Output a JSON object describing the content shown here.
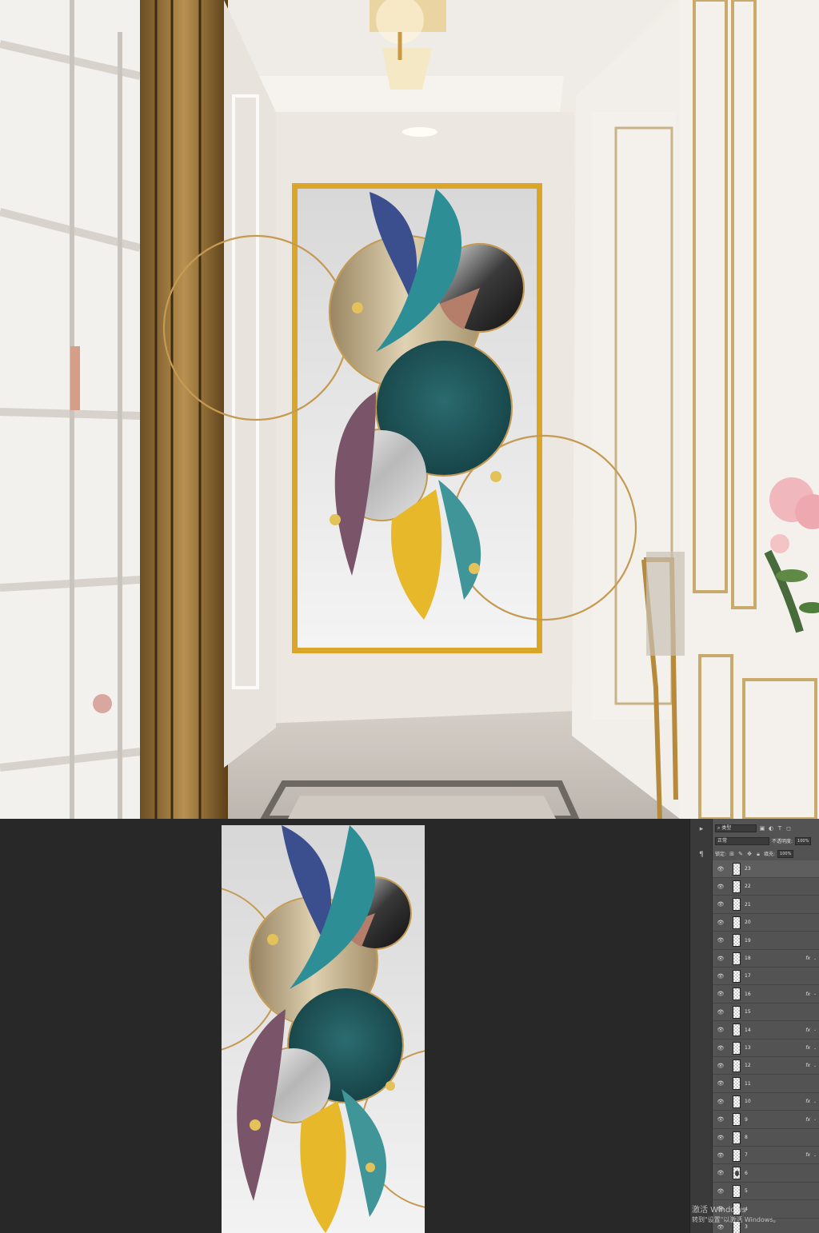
{
  "layers_panel": {
    "filter_kind": "类型",
    "blend_mode": "正常",
    "opacity_label": "不透明度:",
    "opacity_value": "100%",
    "lock_label": "锁定:",
    "fill_label": "填充:",
    "fill_value": "100%",
    "layers": [
      {
        "name": "23",
        "fx": false,
        "selected": true,
        "mark": false
      },
      {
        "name": "22",
        "fx": false,
        "selected": false,
        "mark": false
      },
      {
        "name": "21",
        "fx": false,
        "selected": false,
        "mark": false
      },
      {
        "name": "20",
        "fx": false,
        "selected": false,
        "mark": false
      },
      {
        "name": "19",
        "fx": false,
        "selected": false,
        "mark": false
      },
      {
        "name": "18",
        "fx": true,
        "selected": false,
        "mark": false
      },
      {
        "name": "17",
        "fx": false,
        "selected": false,
        "mark": false
      },
      {
        "name": "16",
        "fx": true,
        "selected": false,
        "mark": false
      },
      {
        "name": "15",
        "fx": false,
        "selected": false,
        "mark": false
      },
      {
        "name": "14",
        "fx": true,
        "selected": false,
        "mark": false
      },
      {
        "name": "13",
        "fx": true,
        "selected": false,
        "mark": false
      },
      {
        "name": "12",
        "fx": true,
        "selected": false,
        "mark": false
      },
      {
        "name": "11",
        "fx": false,
        "selected": false,
        "mark": false
      },
      {
        "name": "10",
        "fx": true,
        "selected": false,
        "mark": false
      },
      {
        "name": "9",
        "fx": true,
        "selected": false,
        "mark": false
      },
      {
        "name": "8",
        "fx": false,
        "selected": false,
        "mark": false
      },
      {
        "name": "7",
        "fx": true,
        "selected": false,
        "mark": false
      },
      {
        "name": "6",
        "fx": false,
        "selected": false,
        "mark": true
      },
      {
        "name": "5",
        "fx": false,
        "selected": false,
        "mark": false
      },
      {
        "name": "4",
        "fx": false,
        "selected": false,
        "mark": false
      },
      {
        "name": "3",
        "fx": false,
        "selected": false,
        "mark": false
      }
    ],
    "fx_label": "fx"
  },
  "watermark": {
    "title": "激活 Windows",
    "subtitle": "转到\"设置\"以激活 Windows。"
  },
  "icons": [
    "eye-icon",
    "search-icon",
    "lock-icon",
    "paragraph-icon",
    "fx-icon",
    "chevron-icon"
  ],
  "colors": {
    "frame_gold": "#d9a62a",
    "panel_bg": "#535353",
    "workspace_bg": "#282828",
    "teal": "#1f5a5e",
    "feather_blue": "#3b4f8f",
    "feather_yellow": "#e6b82a",
    "feather_purple": "#7a5468"
  }
}
